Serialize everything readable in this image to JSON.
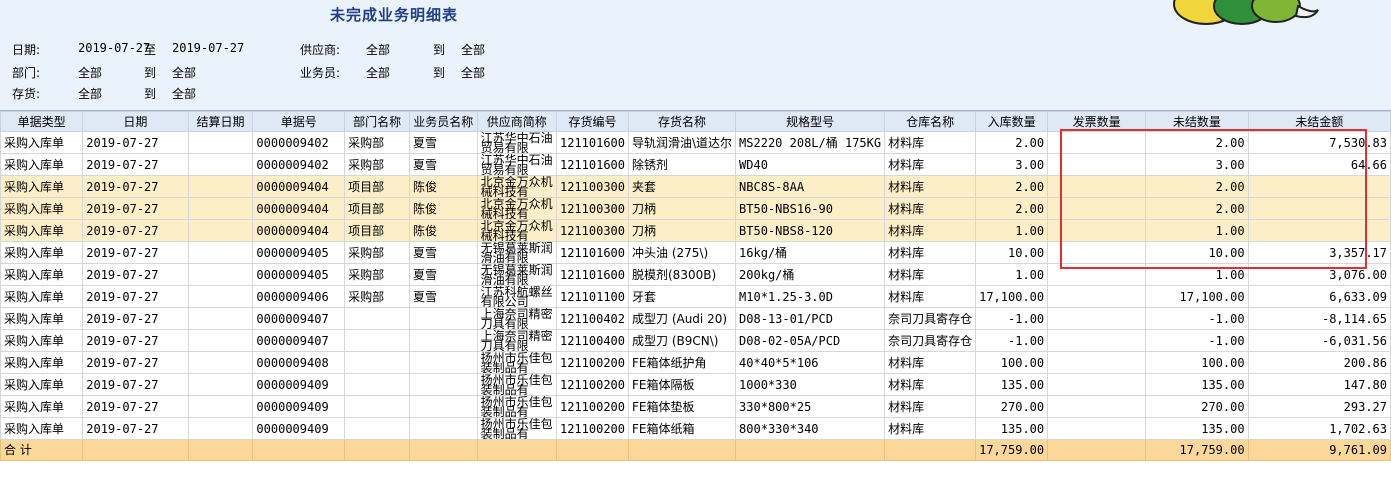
{
  "report": {
    "title": "未完成业务明细表",
    "conditions": {
      "date_label": "日期:",
      "date_from": "2019-07-27",
      "date_to_word": "至",
      "date_to": "2019-07-27",
      "supplier_label": "供应商:",
      "supplier_from": "全部",
      "supplier_to_word": "到",
      "supplier_to": "全部",
      "dept_label": "部门:",
      "dept_from": "全部",
      "dept_to_word": "到",
      "dept_to": "全部",
      "clerk_label": "业务员:",
      "clerk_from": "全部",
      "clerk_to_word": "到",
      "clerk_to": "全部",
      "stock_label": "存货:",
      "stock_from": "全部",
      "stock_to_word": "到",
      "stock_to": "全部"
    }
  },
  "table": {
    "columns": [
      "单据类型",
      "日期",
      "结算日期",
      "单据号",
      "部门名称",
      "业务员名称",
      "供应商简称",
      "存货编号",
      "存货名称",
      "规格型号",
      "仓库名称",
      "入库数量",
      "发票数量",
      "未结数量",
      "未结金额"
    ],
    "rows": [
      {
        "hl": false,
        "c": [
          "采购入库单",
          "2019-07-27",
          "",
          "0000009402",
          "采购部",
          "夏雪",
          "江苏华中石油贸易有限",
          "121101600",
          "导轨润滑油\\道达尔",
          "MS2220 208L/桶 175KG",
          "材料库",
          "2.00",
          "",
          "2.00",
          "7,530.83"
        ]
      },
      {
        "hl": false,
        "c": [
          "采购入库单",
          "2019-07-27",
          "",
          "0000009402",
          "采购部",
          "夏雪",
          "江苏华中石油贸易有限",
          "121101600",
          "除锈剂",
          "WD40",
          "材料库",
          "3.00",
          "",
          "3.00",
          "64.66"
        ]
      },
      {
        "hl": true,
        "c": [
          "采购入库单",
          "2019-07-27",
          "",
          "0000009404",
          "项目部",
          "陈俊",
          "北京金万众机械科技有",
          "121100300",
          "夹套",
          "NBC8S-8AA",
          "材料库",
          "2.00",
          "",
          "2.00",
          ""
        ]
      },
      {
        "hl": true,
        "c": [
          "采购入库单",
          "2019-07-27",
          "",
          "0000009404",
          "项目部",
          "陈俊",
          "北京金万众机械科技有",
          "121100300",
          "刀柄",
          "BT50-NBS16-90",
          "材料库",
          "2.00",
          "",
          "2.00",
          ""
        ]
      },
      {
        "hl": true,
        "c": [
          "采购入库单",
          "2019-07-27",
          "",
          "0000009404",
          "项目部",
          "陈俊",
          "北京金万众机械科技有",
          "121100300",
          "刀柄",
          "BT50-NBS8-120",
          "材料库",
          "1.00",
          "",
          "1.00",
          ""
        ]
      },
      {
        "hl": false,
        "c": [
          "采购入库单",
          "2019-07-27",
          "",
          "0000009405",
          "采购部",
          "夏雪",
          "无锡葛莱斯润滑油有限",
          "121101600",
          "冲头油  (275\\)",
          "16kg/桶",
          "材料库",
          "10.00",
          "",
          "10.00",
          "3,357.17"
        ]
      },
      {
        "hl": false,
        "c": [
          "采购入库单",
          "2019-07-27",
          "",
          "0000009405",
          "采购部",
          "夏雪",
          "无锡葛莱斯润滑油有限",
          "121101600",
          "脱模剂(8300B)",
          "200kg/桶",
          "材料库",
          "1.00",
          "",
          "1.00",
          "3,076.00"
        ]
      },
      {
        "hl": false,
        "c": [
          "采购入库单",
          "2019-07-27",
          "",
          "0000009406",
          "采购部",
          "夏雪",
          "江苏科航螺丝有限公司",
          "121101100",
          "牙套",
          "M10*1.25-3.0D",
          "材料库",
          "17,100.00",
          "",
          "17,100.00",
          "6,633.09"
        ]
      },
      {
        "hl": false,
        "c": [
          "采购入库单",
          "2019-07-27",
          "",
          "0000009407",
          "",
          "",
          "上海奈司精密刀具有限",
          "121100402",
          "成型刀 (Audi 20)",
          "D08-13-01/PCD",
          "奈司刀具寄存仓",
          "-1.00",
          "",
          "-1.00",
          "-8,114.65"
        ]
      },
      {
        "hl": false,
        "c": [
          "采购入库单",
          "2019-07-27",
          "",
          "0000009407",
          "",
          "",
          "上海奈司精密刀具有限",
          "121100400",
          "成型刀 (B9CN\\)",
          "D08-02-05A/PCD",
          "奈司刀具寄存仓",
          "-1.00",
          "",
          "-1.00",
          "-6,031.56"
        ]
      },
      {
        "hl": false,
        "c": [
          "采购入库单",
          "2019-07-27",
          "",
          "0000009408",
          "",
          "",
          "扬州市乐佳包装制品有",
          "121100200",
          "FE箱体纸护角",
          "40*40*5*106",
          "材料库",
          "100.00",
          "",
          "100.00",
          "200.86"
        ]
      },
      {
        "hl": false,
        "c": [
          "采购入库单",
          "2019-07-27",
          "",
          "0000009409",
          "",
          "",
          "扬州市乐佳包装制品有",
          "121100200",
          "FE箱体隔板",
          "1000*330",
          "材料库",
          "135.00",
          "",
          "135.00",
          "147.80"
        ]
      },
      {
        "hl": false,
        "c": [
          "采购入库单",
          "2019-07-27",
          "",
          "0000009409",
          "",
          "",
          "扬州市乐佳包装制品有",
          "121100200",
          "FE箱体垫板",
          "330*800*25",
          "材料库",
          "270.00",
          "",
          "270.00",
          "293.27"
        ]
      },
      {
        "hl": false,
        "c": [
          "采购入库单",
          "2019-07-27",
          "",
          "0000009409",
          "",
          "",
          "扬州市乐佳包装制品有",
          "121100200",
          "FE箱体纸箱",
          "800*330*340",
          "材料库",
          "135.00",
          "",
          "135.00",
          "1,702.63"
        ]
      }
    ],
    "total": {
      "label": "合  计",
      "in_qty": "17,759.00",
      "open_qty": "17,759.00",
      "open_amount": "9,761.09"
    }
  }
}
